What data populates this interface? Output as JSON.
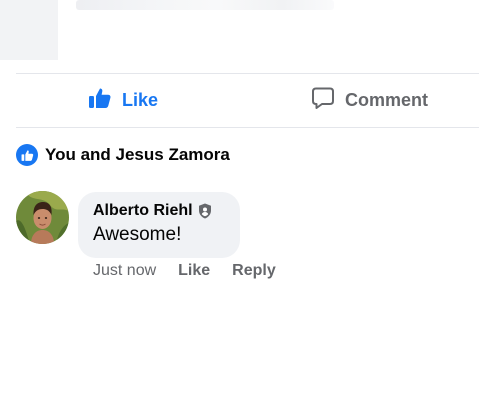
{
  "actions": {
    "like_label": "Like",
    "comment_label": "Comment"
  },
  "reactions": {
    "summary": "You and Jesus Zamora"
  },
  "comment": {
    "author": "Alberto Riehl",
    "text": "Awesome!",
    "time": "Just now",
    "like_label": "Like",
    "reply_label": "Reply"
  },
  "colors": {
    "accent": "#1877f2",
    "muted": "#65676b",
    "bubble": "#f0f2f5"
  }
}
